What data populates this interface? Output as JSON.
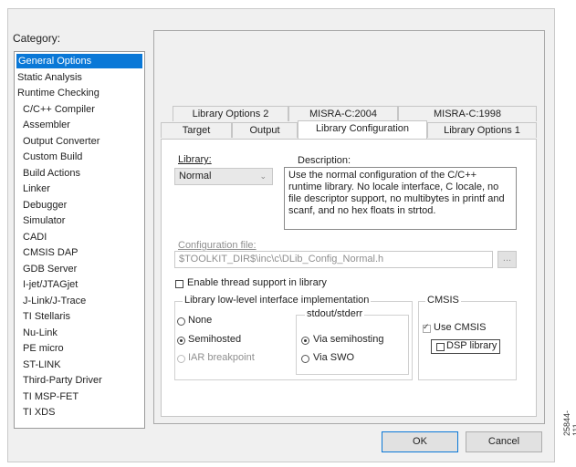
{
  "category": {
    "label": "Category:",
    "items": [
      {
        "label": "General Options",
        "indent": false,
        "selected": true
      },
      {
        "label": "Static Analysis",
        "indent": false
      },
      {
        "label": "Runtime Checking",
        "indent": false
      },
      {
        "label": "C/C++ Compiler",
        "indent": true
      },
      {
        "label": "Assembler",
        "indent": true
      },
      {
        "label": "Output Converter",
        "indent": true
      },
      {
        "label": "Custom Build",
        "indent": true
      },
      {
        "label": "Build Actions",
        "indent": true
      },
      {
        "label": "Linker",
        "indent": true
      },
      {
        "label": "Debugger",
        "indent": true
      },
      {
        "label": "Simulator",
        "indent": true
      },
      {
        "label": "CADI",
        "indent": true
      },
      {
        "label": "CMSIS DAP",
        "indent": true
      },
      {
        "label": "GDB Server",
        "indent": true
      },
      {
        "label": "I-jet/JTAGjet",
        "indent": true
      },
      {
        "label": "J-Link/J-Trace",
        "indent": true
      },
      {
        "label": "TI Stellaris",
        "indent": true
      },
      {
        "label": "Nu-Link",
        "indent": true
      },
      {
        "label": "PE micro",
        "indent": true
      },
      {
        "label": "ST-LINK",
        "indent": true
      },
      {
        "label": "Third-Party Driver",
        "indent": true
      },
      {
        "label": "TI MSP-FET",
        "indent": true
      },
      {
        "label": "TI XDS",
        "indent": true
      }
    ]
  },
  "tabs": {
    "back_row": [
      "Library Options 2",
      "MISRA-C:2004",
      "MISRA-C:1998"
    ],
    "front_row": [
      "Target",
      "Output",
      "Library Configuration",
      "Library Options 1"
    ],
    "active": "Library Configuration"
  },
  "library": {
    "label": "Library:",
    "value": "Normal",
    "description_label": "Description:",
    "description": "Use the normal configuration of the C/C++ runtime library. No locale interface, C locale, no file descriptor support, no multibytes in printf and scanf, and no hex floats in strtod."
  },
  "config_file": {
    "label": "Configuration file:",
    "value": "$TOOLKIT_DIR$\\inc\\c\\DLib_Config_Normal.h",
    "browse": "..."
  },
  "thread_support": {
    "label": "Enable thread support in library",
    "checked": false
  },
  "lowlevel": {
    "title": "Library low-level interface implementation",
    "options": [
      {
        "label": "None",
        "checked": false,
        "disabled": false
      },
      {
        "label": "Semihosted",
        "checked": true,
        "disabled": false
      },
      {
        "label": "IAR breakpoint",
        "checked": false,
        "disabled": true
      }
    ],
    "stdout_title": "stdout/stderr",
    "stdout_options": [
      {
        "label": "Via semihosting",
        "checked": true
      },
      {
        "label": "Via SWO",
        "checked": false
      }
    ]
  },
  "cmsis": {
    "title": "CMSIS",
    "use_cmsis": {
      "label": "Use CMSIS",
      "checked": true
    },
    "dsp_library": {
      "label": "DSP library",
      "checked": false
    }
  },
  "buttons": {
    "ok": "OK",
    "cancel": "Cancel"
  },
  "figure_id": "25844-111"
}
